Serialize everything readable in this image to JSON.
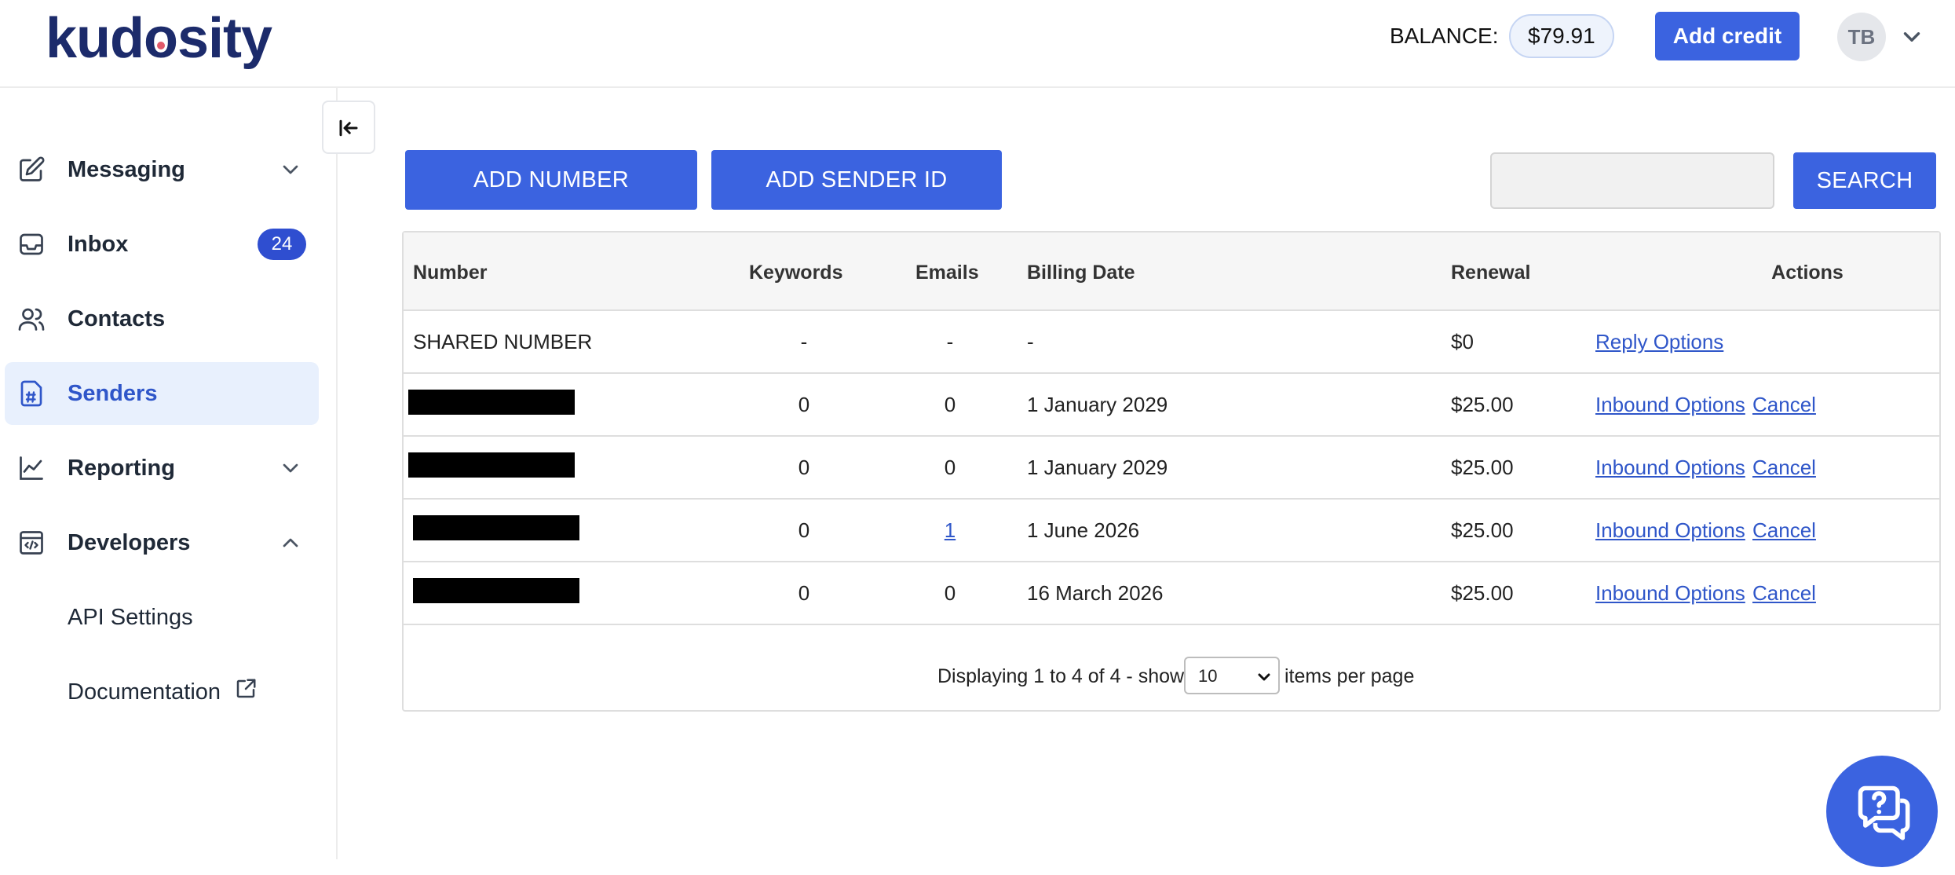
{
  "header": {
    "logo": "kudosity",
    "balance_label": "BALANCE:",
    "balance_value": "$79.91",
    "add_credit_label": "Add credit",
    "avatar_initials": "TB"
  },
  "sidebar": {
    "items": [
      {
        "label": "Messaging",
        "icon": "edit-icon"
      },
      {
        "label": "Inbox",
        "icon": "inbox-icon",
        "badge": "24"
      },
      {
        "label": "Contacts",
        "icon": "contacts-icon"
      },
      {
        "label": "Senders",
        "icon": "senders-icon",
        "active": true
      },
      {
        "label": "Reporting",
        "icon": "chart-line-icon"
      },
      {
        "label": "Developers",
        "icon": "code-window-icon"
      }
    ],
    "developer_subitems": [
      {
        "label": "API Settings"
      },
      {
        "label": "Documentation",
        "icon": "external-link-icon"
      }
    ]
  },
  "toolbar": {
    "add_number_label": "ADD NUMBER",
    "add_sender_id_label": "ADD SENDER ID",
    "search_placeholder": "",
    "search_label": "SEARCH"
  },
  "table": {
    "headers": {
      "number": "Number",
      "keywords": "Keywords",
      "emails": "Emails",
      "billing_date": "Billing Date",
      "renewal": "Renewal",
      "actions": "Actions"
    },
    "rows": [
      {
        "number": "SHARED NUMBER",
        "keywords": "-",
        "emails": "-",
        "billing_date": "-",
        "renewal": "$0",
        "action1": "Reply Options",
        "action2": ""
      },
      {
        "number": "",
        "keywords": "0",
        "emails": "0",
        "billing_date": "1 January 2029",
        "renewal": "$25.00",
        "action1": "Inbound Options",
        "action2": "Cancel"
      },
      {
        "number": "",
        "keywords": "0",
        "emails": "0",
        "billing_date": "1 January 2029",
        "renewal": "$25.00",
        "action1": "Inbound Options",
        "action2": "Cancel"
      },
      {
        "number": "",
        "keywords": "0",
        "emails": "1",
        "billing_date": "1 June 2026",
        "renewal": "$25.00",
        "action1": "Inbound Options",
        "action2": "Cancel"
      },
      {
        "number": "",
        "keywords": "0",
        "emails": "0",
        "billing_date": "16 March 2026",
        "renewal": "$25.00",
        "action1": "Inbound Options",
        "action2": "Cancel"
      }
    ],
    "footer": {
      "displaying": "Displaying 1 to 4 of 4 - show",
      "per_page_value": "10",
      "items_per_page": "items per page"
    }
  },
  "colors": {
    "accent": "#3b63e0",
    "link": "#2f56c9",
    "active_bg": "#e8f0fd",
    "logo": "#1c2b6b"
  }
}
